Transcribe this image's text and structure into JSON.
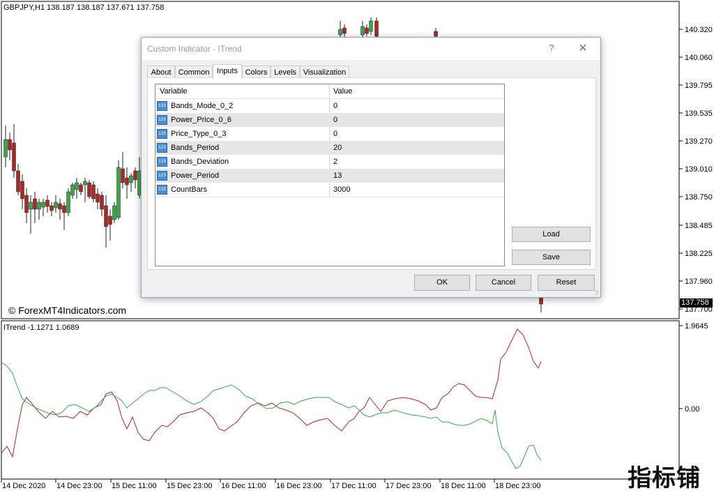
{
  "chart": {
    "title": "GBPJPY,H1  138.187 138.187 137.671 137.758",
    "copyright": "© ForexMT4Indicators.com",
    "price_axis": [
      "140.320",
      "140.060",
      "139.795",
      "139.535",
      "139.270",
      "139.010",
      "138.750",
      "138.485",
      "138.225",
      "137.960",
      "137.700"
    ],
    "current_price": "137.758",
    "indicator_label": "ITrend -1.1271 1.0689",
    "indicator_axis": [
      "1.9645",
      "0.00"
    ],
    "time_axis": [
      "14 Dec 2020",
      "14 Dec 23:00",
      "15 Dec 11:00",
      "15 Dec 23:00",
      "16 Dec 11:00",
      "16 Dec 23:00",
      "17 Dec 11:00",
      "17 Dec 23:00",
      "18 Dec 11:00",
      "18 Dec 23:00"
    ],
    "watermark": "指标铺",
    "colors": {
      "bull": "#3fa34d",
      "bear": "#a52a2a",
      "indicator_red": "#a52a2a",
      "indicator_green": "#3fa34d"
    }
  },
  "dialog": {
    "title": "Custom Indicator - ITrend",
    "help": "?",
    "close": "✕",
    "tabs": [
      "About",
      "Common",
      "Inputs",
      "Colors",
      "Levels",
      "Visualization"
    ],
    "active_tab": "Inputs",
    "columns": {
      "variable": "Variable",
      "value": "Value"
    },
    "params": [
      {
        "name": "Bands_Mode_0_2",
        "value": "0"
      },
      {
        "name": "Power_Price_0_6",
        "value": "0"
      },
      {
        "name": "Price_Type_0_3",
        "value": "0"
      },
      {
        "name": "Bands_Period",
        "value": "20"
      },
      {
        "name": "Bands_Deviation",
        "value": "2"
      },
      {
        "name": "Power_Period",
        "value": "13"
      },
      {
        "name": "CountBars",
        "value": "3000"
      }
    ],
    "param_icon": "123",
    "buttons": {
      "load": "Load",
      "save": "Save",
      "ok": "OK",
      "cancel": "Cancel",
      "reset": "Reset"
    }
  }
}
